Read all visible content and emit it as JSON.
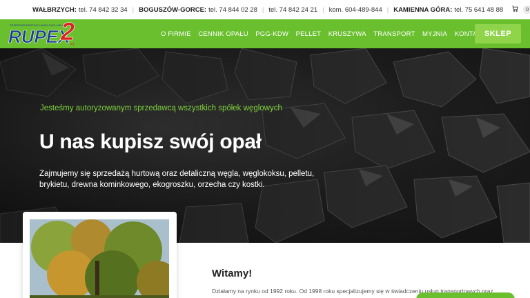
{
  "topbar": {
    "walbrzych_label": "WAŁBRZYCH:",
    "walbrzych_phone": "tel. 74 842 32 34",
    "boguszow_label": "BOGUSZÓW-GORCE:",
    "boguszow_phone1": "tel. 74 844 02 28",
    "boguszow_phone2": "tel. 74 842 24 21",
    "boguszow_mobile": "kom. 604-489-844",
    "kamienna_label": "KAMIENNA GÓRA:",
    "kamienna_phone": "tel. 75 641 48 88",
    "cart_count": "0"
  },
  "logo": {
    "text": "RUPEX",
    "number": "2",
    "suffix": "s.j.",
    "tagline": "PRZEDSIĘBIORSTWO HANDLOWO-USŁUGOWE"
  },
  "nav": {
    "items": [
      "O FIRMIE",
      "CENNIK OPAŁU",
      "PGG-KDW",
      "PELLET",
      "KRUSZYWA",
      "TRANSPORT",
      "MYJNIA",
      "KONTAKT"
    ],
    "shop_label": "SKLEP"
  },
  "hero": {
    "tagline": "Jesteśmy autoryzowanym sprzedawcą wszystkich spółek węglowych",
    "headline": "U nas kupisz swój opał",
    "description": "Zajmujemy się sprzedażą hurtową oraz detaliczną węgla, węglokoksu, pelletu, brykietu, drewna kominkowego, ekogroszku, orzecha czy kostki."
  },
  "welcome": {
    "title": "Witamy!",
    "intro": "Działamy na rynku od 1992 roku. Od 1998 roku specjalizujemy się w świadczeniu usług transportowych oraz"
  },
  "colors": {
    "brand_green": "#6abf2e",
    "accent_green": "#7ed23c",
    "logo_blue": "#1a3d8f",
    "logo_red": "#d9231d"
  }
}
